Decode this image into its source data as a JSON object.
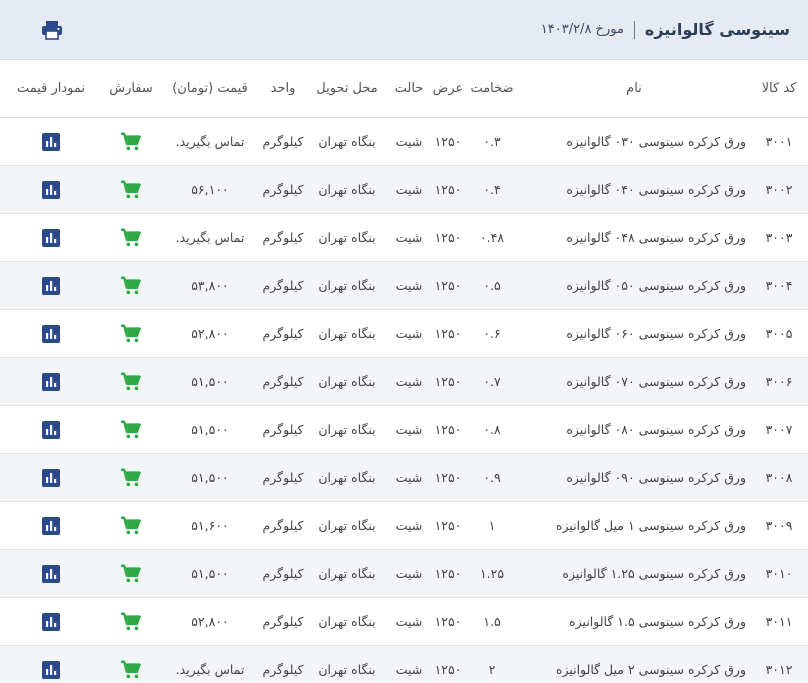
{
  "header": {
    "title": "سینوسی گالوانیزه",
    "date_label": "مورخ ۱۴۰۳/۲/۸"
  },
  "icons": {
    "print": "printer-icon",
    "order": "cart-icon",
    "chart": "bar-chart-icon"
  },
  "colors": {
    "header_bg": "#e6ebf3",
    "cart": "#2faa44",
    "chart": "#2c4a8a",
    "row_alt": "#f4f5f8"
  },
  "columns": {
    "code": "کد کالا",
    "name": "نام",
    "thickness": "ضخامت",
    "width": "عرض",
    "state": "حالت",
    "delivery": "محل تحویل",
    "unit": "واحد",
    "price": "قیمت (تومان)",
    "order": "سفارش",
    "chart": "نمودار قیمت"
  },
  "rows": [
    {
      "code": "۳۰۰۱",
      "name": "ورق کرکره سینوسی ۰۳۰ گالوانیزه",
      "thickness": "۰.۳",
      "width": "۱۲۵۰",
      "state": "شیت",
      "delivery": "بنگاه تهران",
      "unit": "کیلوگرم",
      "price": "تماس بگیرید."
    },
    {
      "code": "۳۰۰۲",
      "name": "ورق کرکره سینوسی ۰۴۰ گالوانیزه",
      "thickness": "۰.۴",
      "width": "۱۲۵۰",
      "state": "شیت",
      "delivery": "بنگاه تهران",
      "unit": "کیلوگرم",
      "price": "۵۶,۱۰۰"
    },
    {
      "code": "۳۰۰۳",
      "name": "ورق کرکره سینوسی ۰۴۸ گالوانیزه",
      "thickness": "۰.۴۸",
      "width": "۱۲۵۰",
      "state": "شیت",
      "delivery": "بنگاه تهران",
      "unit": "کیلوگرم",
      "price": "تماس بگیرید."
    },
    {
      "code": "۳۰۰۴",
      "name": "ورق کرکره سینوسی ۰۵۰ گالوانیزه",
      "thickness": "۰.۵",
      "width": "۱۲۵۰",
      "state": "شیت",
      "delivery": "بنگاه تهران",
      "unit": "کیلوگرم",
      "price": "۵۳,۸۰۰"
    },
    {
      "code": "۳۰۰۵",
      "name": "ورق کرکره سینوسی ۰۶۰ گالوانیزه",
      "thickness": "۰.۶",
      "width": "۱۲۵۰",
      "state": "شیت",
      "delivery": "بنگاه تهران",
      "unit": "کیلوگرم",
      "price": "۵۲,۸۰۰"
    },
    {
      "code": "۳۰۰۶",
      "name": "ورق کرکره سینوسی ۰۷۰ گالوانیزه",
      "thickness": "۰.۷",
      "width": "۱۲۵۰",
      "state": "شیت",
      "delivery": "بنگاه تهران",
      "unit": "کیلوگرم",
      "price": "۵۱,۵۰۰"
    },
    {
      "code": "۳۰۰۷",
      "name": "ورق کرکره سینوسی ۰۸۰ گالوانیزه",
      "thickness": "۰.۸",
      "width": "۱۲۵۰",
      "state": "شیت",
      "delivery": "بنگاه تهران",
      "unit": "کیلوگرم",
      "price": "۵۱,۵۰۰"
    },
    {
      "code": "۳۰۰۸",
      "name": "ورق کرکره سینوسی ۰۹۰ گالوانیزه",
      "thickness": "۰.۹",
      "width": "۱۲۵۰",
      "state": "شیت",
      "delivery": "بنگاه تهران",
      "unit": "کیلوگرم",
      "price": "۵۱,۵۰۰"
    },
    {
      "code": "۳۰۰۹",
      "name": "ورق کرکره سینوسی ۱ میل گالوانیزه",
      "thickness": "۱",
      "width": "۱۲۵۰",
      "state": "شیت",
      "delivery": "بنگاه تهران",
      "unit": "کیلوگرم",
      "price": "۵۱,۶۰۰"
    },
    {
      "code": "۳۰۱۰",
      "name": "ورق کرکره سینوسی ۱.۲۵ گالوانیزه",
      "thickness": "۱.۲۵",
      "width": "۱۲۵۰",
      "state": "شیت",
      "delivery": "بنگاه تهران",
      "unit": "کیلوگرم",
      "price": "۵۱,۵۰۰"
    },
    {
      "code": "۳۰۱۱",
      "name": "ورق کرکره سینوسی ۱.۵ گالوانیزه",
      "thickness": "۱.۵",
      "width": "۱۲۵۰",
      "state": "شیت",
      "delivery": "بنگاه تهران",
      "unit": "کیلوگرم",
      "price": "۵۲,۸۰۰"
    },
    {
      "code": "۳۰۱۲",
      "name": "ورق کرکره سینوسی ۲ میل گالوانیزه",
      "thickness": "۲",
      "width": "۱۲۵۰",
      "state": "شیت",
      "delivery": "بنگاه تهران",
      "unit": "کیلوگرم",
      "price": "تماس بگیرید."
    }
  ]
}
